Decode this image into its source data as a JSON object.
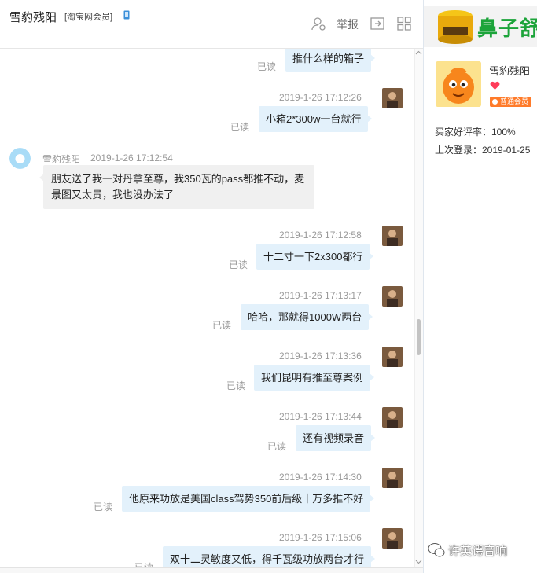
{
  "header": {
    "contact_name": "雪豹残阳",
    "member_tag": "[淘宝网会员]",
    "report_label": "举报"
  },
  "chat": {
    "messages": [
      {
        "dir": "out",
        "text": "推什么样的箱子",
        "read": "已读"
      },
      {
        "dir": "out",
        "timestamp": "2019-1-26 17:12:26",
        "text": "小箱2*300w一台就行",
        "read": "已读"
      },
      {
        "dir": "in",
        "sender": "雪豹残阳",
        "timestamp": "2019-1-26 17:12:54",
        "text": "朋友送了我一对丹拿至尊，我350瓦的pass都推不动，麦景图又太贵，我也没办法了"
      },
      {
        "dir": "out",
        "timestamp": "2019-1-26 17:12:58",
        "text": "十二寸一下2x300都行",
        "read": "已读"
      },
      {
        "dir": "out",
        "timestamp": "2019-1-26 17:13:17",
        "text": "哈哈，那就得1000W两台",
        "read": "已读"
      },
      {
        "dir": "out",
        "timestamp": "2019-1-26 17:13:36",
        "text": "我们昆明有推至尊案例",
        "read": "已读"
      },
      {
        "dir": "out",
        "timestamp": "2019-1-26 17:13:44",
        "text": "还有视频录音",
        "read": "已读"
      },
      {
        "dir": "out",
        "timestamp": "2019-1-26 17:14:30",
        "text": "他原来功放是美国class驾势350前后级十万多推不好",
        "read": "已读"
      },
      {
        "dir": "out",
        "timestamp": "2019-1-26 17:15:06",
        "text": "双十二灵敏度又低，得千瓦级功放两台才行",
        "read": "已读"
      }
    ]
  },
  "sidebar": {
    "ad_text": "鼻子舒",
    "profile_name": "雪豹残阳",
    "member_badge": "普通会员",
    "rating": "买家好评率：100%",
    "last_login": "上次登录：2019-01-25"
  },
  "watermark": "许英谔音响",
  "colors": {
    "bubble_out": "#e3f1fb",
    "bubble_in": "#f0f0f0",
    "ad_green": "#1ca43a",
    "badge_orange": "#ff7b2a"
  }
}
